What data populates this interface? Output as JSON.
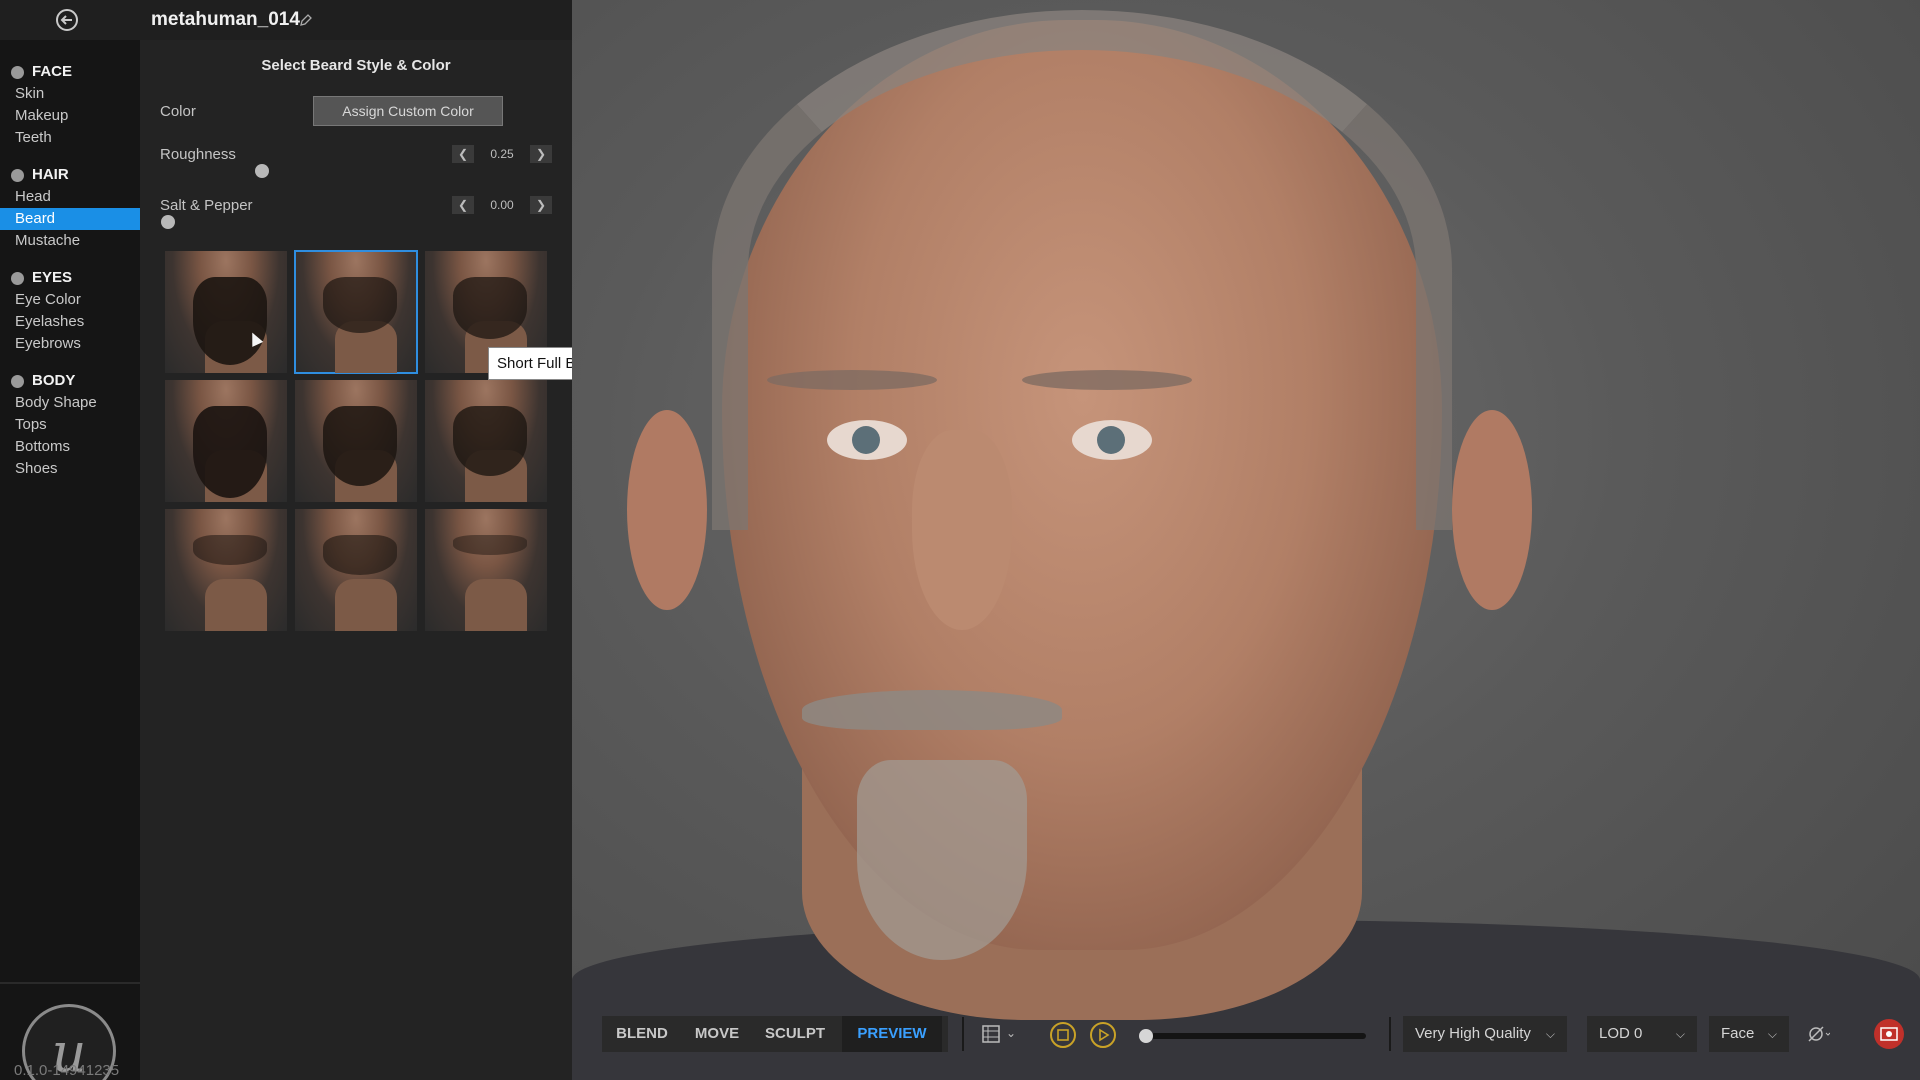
{
  "header": {
    "project_name": "metahuman_014"
  },
  "sidebar": {
    "sections": [
      {
        "title": "FACE",
        "items": [
          "Skin",
          "Makeup",
          "Teeth"
        ]
      },
      {
        "title": "HAIR",
        "items": [
          "Head",
          "Beard",
          "Mustache"
        ]
      },
      {
        "title": "EYES",
        "items": [
          "Eye Color",
          "Eyelashes",
          "Eyebrows"
        ]
      },
      {
        "title": "BODY",
        "items": [
          "Body Shape",
          "Tops",
          "Bottoms",
          "Shoes"
        ]
      }
    ],
    "active_item": "Beard",
    "version": "0.1.0-14941235"
  },
  "panel": {
    "title": "Select Beard Style & Color",
    "color_label": "Color",
    "assign_button": "Assign Custom Color",
    "roughness": {
      "label": "Roughness",
      "value": "0.25"
    },
    "salt_pepper": {
      "label": "Salt & Pepper",
      "value": "0.00"
    },
    "selected_style_index": 1,
    "tooltip": "Short Full Beard"
  },
  "toolbar": {
    "modes": [
      "BLEND",
      "MOVE",
      "SCULPT",
      "PREVIEW"
    ],
    "active_mode": "PREVIEW",
    "quality": "Very High Quality",
    "lod": "LOD 0",
    "camera": "Face",
    "timeline_progress": 0.0
  },
  "icons": {
    "back": "back-arrow-icon",
    "edit": "pencil-icon",
    "stop": "stop-icon",
    "play": "play-icon"
  },
  "colors": {
    "accent": "#1a8fe6",
    "preview_active": "#3aa0ff",
    "play_ring": "#c9a227"
  }
}
